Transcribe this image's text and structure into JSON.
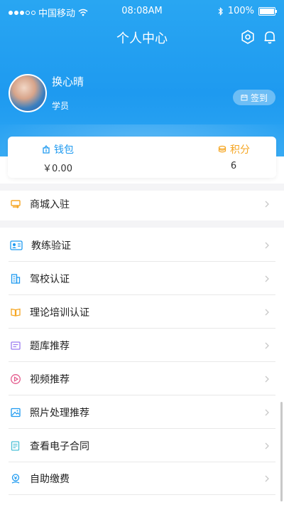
{
  "status_bar": {
    "carrier": "中国移动",
    "time": "08:08AM",
    "battery": "100%"
  },
  "nav": {
    "title": "个人中心",
    "icons": [
      "settings-icon",
      "bell-icon"
    ]
  },
  "profile": {
    "name": "换心晴",
    "role": "学员",
    "signin_label": "签到"
  },
  "wallet": {
    "label": "钱包",
    "value": "￥0.00",
    "color": "#1e9af0"
  },
  "points": {
    "label": "积分",
    "value": "6",
    "color": "#f5a623"
  },
  "menu": [
    {
      "label": "商城入驻",
      "icon": "store-icon"
    },
    {
      "label": "教练验证",
      "icon": "id-card-icon"
    },
    {
      "label": "驾校认证",
      "icon": "building-icon"
    },
    {
      "label": "理论培训认证",
      "icon": "book-icon"
    },
    {
      "label": "题库推荐",
      "icon": "question-bank-icon"
    },
    {
      "label": "视频推荐",
      "icon": "play-icon"
    },
    {
      "label": "照片处理推荐",
      "icon": "photo-icon"
    },
    {
      "label": "查看电子合同",
      "icon": "contract-icon"
    },
    {
      "label": "自助缴费",
      "icon": "payment-icon"
    }
  ],
  "colors": {
    "primary": "#1e9af0",
    "orange": "#f5a623",
    "purple": "#9b7bf0"
  }
}
